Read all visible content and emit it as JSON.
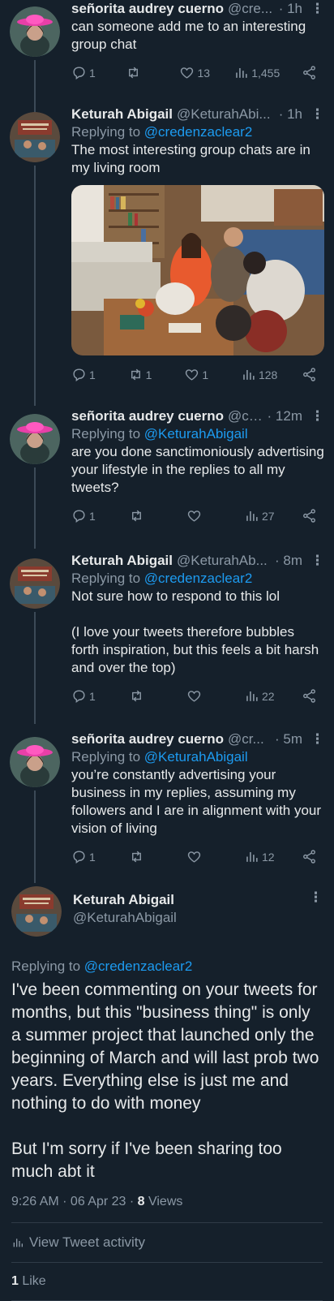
{
  "tweets": [
    {
      "name": "señorita audrey cuerno",
      "handle": "@cre...",
      "time": "· 1h",
      "replying_to_label": "",
      "replying_to_handle": "",
      "text": "can someone add me to an interesting group chat",
      "replies": "1",
      "retweets": "",
      "likes": "13",
      "views": "1,455"
    },
    {
      "name": "Keturah Abigail",
      "handle": "@KeturahAbi...",
      "time": "· 1h",
      "replying_to_label": "Replying to ",
      "replying_to_handle": "@credenzaclear2",
      "text": "The most interesting group chats are in my living room",
      "replies": "1",
      "retweets": "1",
      "likes": "1",
      "views": "128"
    },
    {
      "name": "señorita audrey cuerno",
      "handle": "@cr...",
      "time": "· 12m",
      "replying_to_label": "Replying to ",
      "replying_to_handle": "@KeturahAbigail",
      "text": "are you done sanctimoniously advertising your lifestyle in the replies to all my tweets?",
      "replies": "1",
      "retweets": "",
      "likes": "",
      "views": "27"
    },
    {
      "name": "Keturah Abigail",
      "handle": "@KeturahAb...",
      "time": "· 8m",
      "replying_to_label": "Replying to ",
      "replying_to_handle": "@credenzaclear2",
      "text": "Not sure how to respond to this lol\n\n(I love your tweets therefore bubbles forth inspiration, but this feels a bit harsh and over the top)",
      "replies": "1",
      "retweets": "",
      "likes": "",
      "views": "22"
    },
    {
      "name": "señorita audrey cuerno",
      "handle": "@cr...",
      "time": "· 5m",
      "replying_to_label": "Replying to ",
      "replying_to_handle": "@KeturahAbigail",
      "text": "you’re constantly advertising your business in my replies, assuming my followers and I are in alignment with your vision of living",
      "replies": "1",
      "retweets": "",
      "likes": "",
      "views": "12"
    }
  ],
  "main": {
    "name": "Keturah Abigail",
    "handle": "@KeturahAbigail",
    "replying_to_label": "Replying to ",
    "replying_to_handle": "@credenzaclear2",
    "text": "I've been commenting on your tweets for months, but this \"business thing\" is only a summer project that launched only the beginning of March and will last prob two years. Everything else is just me and nothing to do with money\n\nBut I'm sorry if I've been sharing too much abt it",
    "timestamp": "9:26 AM · 06 Apr 23 · ",
    "views_count": "8",
    "views_label": " Views",
    "activity_label": "View Tweet activity",
    "likes_count": "1",
    "likes_label": " Like"
  },
  "colors": {
    "background": "#15202b",
    "link": "#1d9bf0",
    "muted": "#8b98a5",
    "text": "#e7e9ea"
  }
}
